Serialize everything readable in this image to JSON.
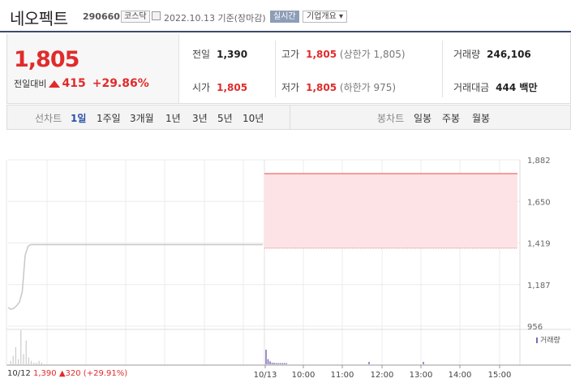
{
  "header": {
    "name": "네오펙트",
    "code": "290660",
    "market": "코스닥",
    "date": "2022.10.13",
    "basis": "기준(장마감)",
    "realtime": "실시간",
    "overview": "기업개요 ▾"
  },
  "quote": {
    "price": "1,805",
    "change_label": "전일대비",
    "change": "415",
    "change_pct": "+29.86%",
    "prev_close_label": "전일",
    "prev_close": "1,390",
    "open_label": "시가",
    "open": "1,805",
    "high_label": "고가",
    "high": "1,805",
    "upper_limit": "(상한가 1,805)",
    "low_label": "저가",
    "low": "1,805",
    "lower_limit": "(하한가 975)",
    "volume_label": "거래량",
    "volume": "246,106",
    "value_label": "거래대금",
    "value": "444 백만"
  },
  "tabs": {
    "line_label": "선차트",
    "line": [
      "1일",
      "1주일",
      "3개월",
      "1년",
      "3년",
      "5년",
      "10년"
    ],
    "line_active": 0,
    "candle_label": "봉차트",
    "candle": [
      "일봉",
      "주봉",
      "월봉"
    ]
  },
  "colors": {
    "up": "#e12b2b",
    "line": "#c7c7c7",
    "volume": "#7e6bb5",
    "band": "#fde3e5",
    "band_line": "#f07f82"
  },
  "chart_data": {
    "type": "line",
    "y_ticks": [
      "1,882",
      "1,650",
      "1,419",
      "1,187",
      "956"
    ],
    "ylim": [
      956,
      1882
    ],
    "x_ticks": [
      "10/12",
      "10/13",
      "10:00",
      "11:00",
      "12:00",
      "13:00",
      "14:00",
      "15:00"
    ],
    "series": [
      {
        "name": "10/12",
        "values": [
          1060,
          1050,
          1055,
          1070,
          1090,
          1150,
          1350,
          1400,
          1410,
          1410,
          1410,
          1410,
          1410,
          1410,
          1410,
          1410,
          1410,
          1410,
          1410,
          1410,
          1410,
          1410,
          1410,
          1410,
          1410,
          1410,
          1410,
          1410,
          1410,
          1410
        ]
      },
      {
        "name": "10/13",
        "values": [
          1805,
          1805
        ]
      }
    ],
    "prev_close": 1390,
    "volume_label": "거래량",
    "volume_prev_day": [
      0.1,
      0.25,
      0.5,
      0.15,
      1.0,
      0.3,
      0.7,
      0.2,
      0.1,
      0.05,
      0.05,
      0.1,
      0.05
    ],
    "volume_today": [
      1.0,
      0.35,
      0.2,
      0.1,
      0.1,
      0.08,
      0.08,
      0.08,
      0.08,
      0.08,
      0.08
    ],
    "grid": true
  },
  "footer": {
    "date": "10/12",
    "price": "1,390",
    "change": "▲320 (+29.91%)"
  }
}
